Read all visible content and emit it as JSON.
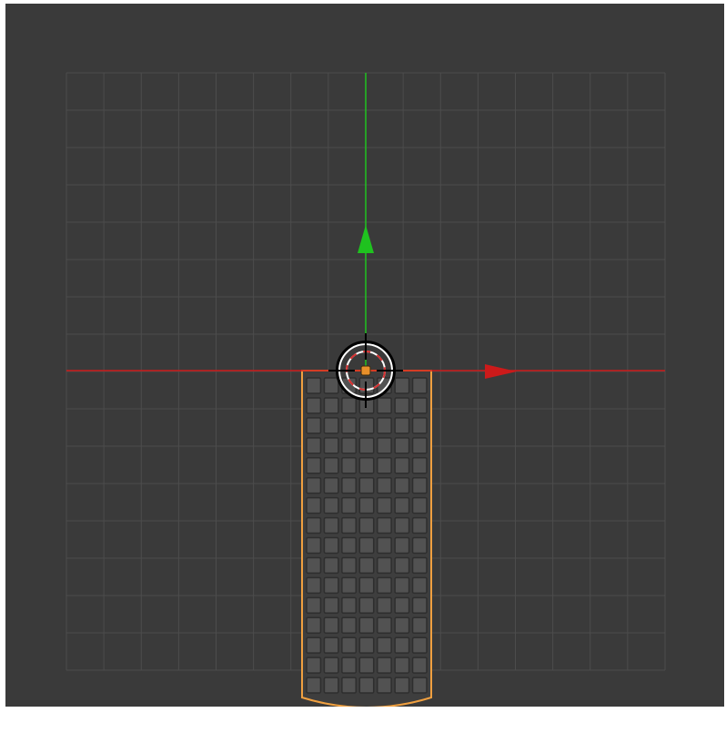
{
  "viewport": {
    "background": "#3a3a3a",
    "grid_color": "#4c4c4c",
    "grid_divisions": 16
  },
  "axes": {
    "x_axis_color": "#cc1a1a",
    "y_axis_color": "#1fc21f"
  },
  "gizmo": {
    "ring_color": "#ffffff",
    "dash_color": "#d83030",
    "origin_color": "#e8902a"
  },
  "object": {
    "outline_color": "#f0a040",
    "fill_color": "#3e3e3e",
    "cell_rows": 16,
    "cell_cols": 7,
    "cell_color": "#525252",
    "cell_edge_color": "#2e2e2e"
  }
}
